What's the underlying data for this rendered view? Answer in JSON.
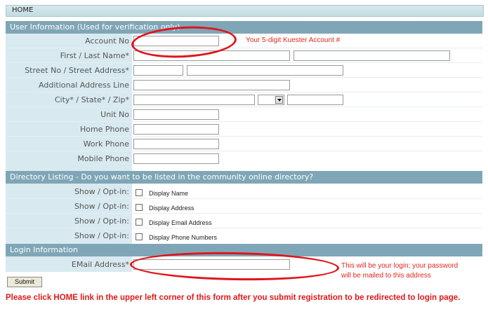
{
  "home": {
    "label": "HOME"
  },
  "user_info": {
    "title": "User Information (Used for verification only)",
    "fields": {
      "account_no": "Account No",
      "name": "First / Last Name*",
      "street": "Street No / Street Address*",
      "additional": "Additional Address Line",
      "city": "City* / State* / Zip*",
      "unit": "Unit No",
      "home_phone": "Home Phone",
      "work_phone": "Work Phone",
      "mobile_phone": "Mobile Phone"
    },
    "account_note": "Your 5-digit Kuester Account #"
  },
  "directory": {
    "title": "Directory Listing - Do you want to be listed in the community online directory?",
    "rows": [
      {
        "label": "Show / Opt-in:",
        "option": "Display Name"
      },
      {
        "label": "Show / Opt-in:",
        "option": "Display Address"
      },
      {
        "label": "Show / Opt-in:",
        "option": "Display Email Address"
      },
      {
        "label": "Show / Opt-in:",
        "option": "Display Phone Numbers"
      }
    ]
  },
  "login": {
    "title": "Login Information",
    "email_label": "EMail Address*",
    "note_line1": "This will be your login; your password",
    "note_line2": "will be mailed to this address"
  },
  "submit_label": "Submit",
  "bottom_message": "Please click HOME link in the upper left corner of this form after you submit registration to be redirected to login page.",
  "colors": {
    "section_bar": "#7fa6b6",
    "label_bg": "#d8eaf0",
    "annotation_red": "#e1141c"
  }
}
